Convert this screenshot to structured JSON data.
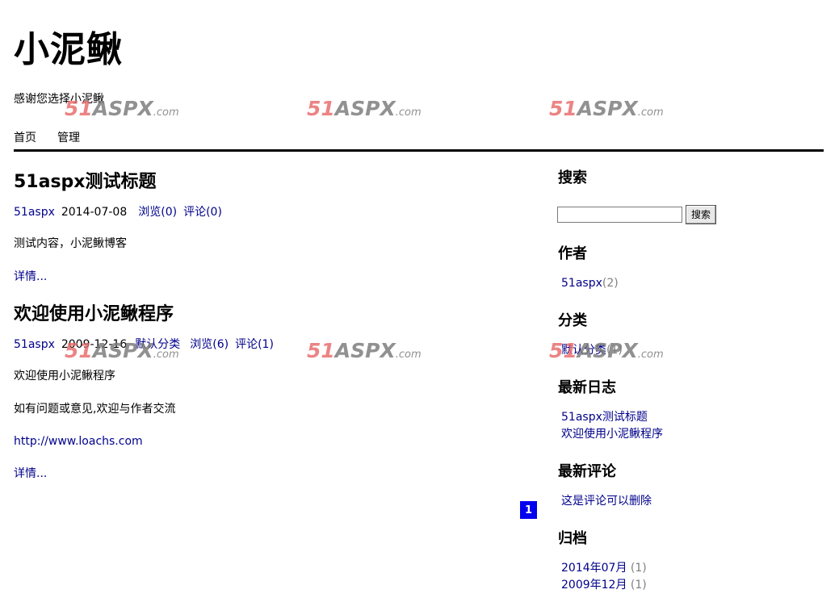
{
  "site": {
    "title": "小泥鳅",
    "description": "感谢您选择小泥鳅"
  },
  "nav": {
    "items": [
      "首页",
      "管理"
    ]
  },
  "posts": [
    {
      "title": "51aspx测试标题",
      "author": "51aspx",
      "date": "2014-07-08",
      "views": "浏览(0)",
      "comments": "评论(0)",
      "paragraphs": [
        "测试内容，小泥鳅博客"
      ],
      "more": "详情..."
    },
    {
      "title": "欢迎使用小泥鳅程序",
      "author": "51aspx",
      "date": "2009-12-16",
      "category": "默认分类",
      "views": "浏览(6)",
      "comments": "评论(1)",
      "paragraphs": [
        "欢迎使用小泥鳅程序",
        "如有问题或意见,欢迎与作者交流"
      ],
      "link": "http://www.loachs.com",
      "more": "详情..."
    }
  ],
  "pager": {
    "current": "1"
  },
  "sidebar": {
    "search": {
      "heading": "搜索",
      "input_value": "",
      "button_label": "搜索"
    },
    "authors": {
      "heading": "作者",
      "items": [
        {
          "name": "51aspx",
          "count": "(2)"
        }
      ]
    },
    "categories": {
      "heading": "分类",
      "items": [
        {
          "name": "默认分类",
          "count": "(1)"
        }
      ]
    },
    "recent_posts": {
      "heading": "最新日志",
      "items": [
        "51aspx测试标题",
        "欢迎使用小泥鳅程序"
      ]
    },
    "recent_comments": {
      "heading": "最新评论",
      "items": [
        "这是评论可以删除"
      ]
    },
    "archives": {
      "heading": "归档",
      "items": [
        {
          "name": "2014年07月",
          "count": "(1)"
        },
        {
          "name": "2009年12月",
          "count": "(1)"
        }
      ]
    }
  },
  "watermark": {
    "part1": "51",
    "part2": "ASPX",
    "part3": ".com"
  },
  "colors": {
    "link": "#00008b",
    "pager_bg": "#0000ee",
    "watermark_red": "#e86a6a",
    "watermark_gray": "#7a7a7a"
  }
}
